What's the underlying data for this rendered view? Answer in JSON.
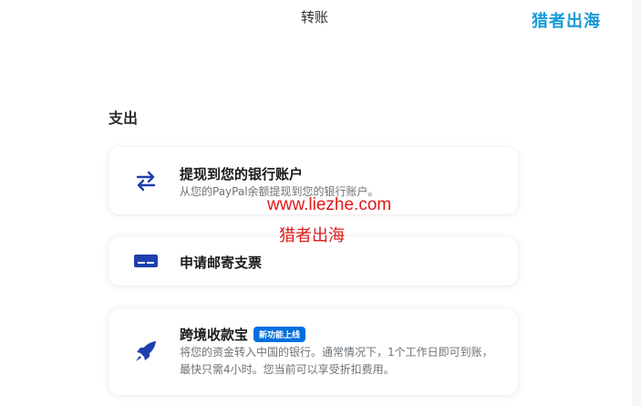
{
  "header": {
    "title": "转账",
    "brand": "猎者出海"
  },
  "section": {
    "heading": "支出"
  },
  "cards": {
    "withdraw": {
      "icon": "transfer-arrows-icon",
      "title": "提现到您的银行账户",
      "description": "从您的PayPal余额提现到您的银行账户。"
    },
    "check": {
      "icon": "check-card-icon",
      "title": "申请邮寄支票"
    },
    "crossborder": {
      "icon": "rocket-icon",
      "title": "跨境收款宝",
      "badge": "新功能上线",
      "description": "将您的资金转入中国的银行。通常情况下，1个工作日即可到账，最快只需4小时。您当前可以享受折扣费用。"
    }
  },
  "watermark": {
    "url": "www.liezhe.com",
    "text": "猎者出海"
  },
  "colors": {
    "accent": "#0070e0",
    "icon": "#1f3fae",
    "brand": "#169ad8",
    "watermark": "#e0181a"
  }
}
